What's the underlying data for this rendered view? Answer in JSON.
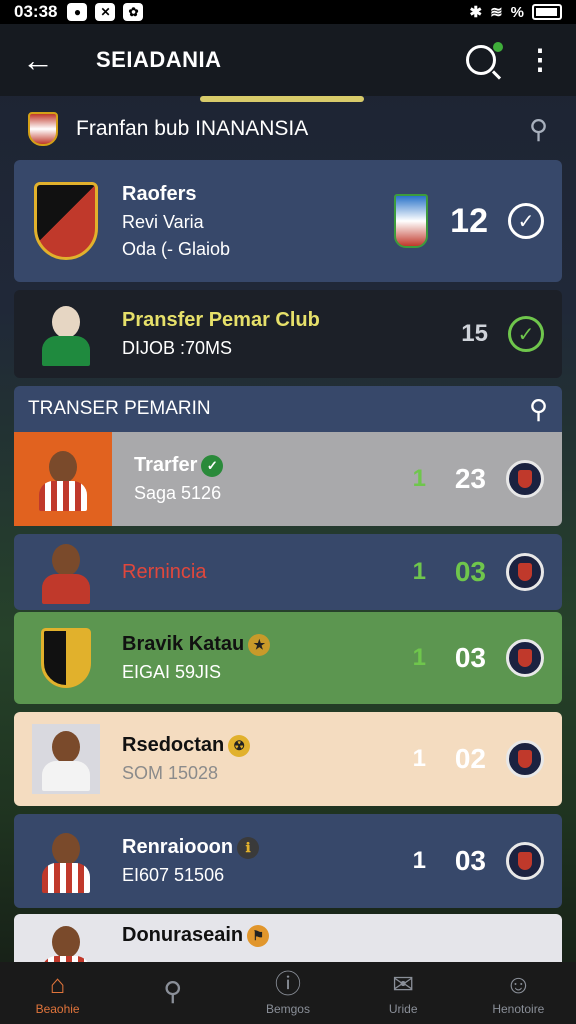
{
  "status_bar": {
    "time": "03:38",
    "battery": "%"
  },
  "app_bar": {
    "title": "SEIADANIA",
    "back_icon": "back-arrow-icon"
  },
  "section": {
    "title": "Franfan bub INANANSIA"
  },
  "cards": [
    {
      "name": "Raofers",
      "line1": "Revi Varia",
      "line2": "Oda (- Glaiob",
      "score": "12"
    },
    {
      "name": "Pransfer Pemar Club",
      "line2": "DIJOB :70MS",
      "score": "15"
    }
  ],
  "transfer": {
    "title": "TRANSER PEMARIN",
    "rows": [
      {
        "name": "Trarfer",
        "sub": "Saga 5126",
        "small": "1",
        "score": "23"
      },
      {
        "name": "Rernincia",
        "sub": "",
        "small": "1",
        "score": "03"
      },
      {
        "name": "Bravik Katau",
        "sub": "EIGAI 59JIS",
        "small": "1",
        "score": "03"
      },
      {
        "name": "Rsedoctan",
        "sub": "SOM 15028",
        "small": "1",
        "score": "02"
      },
      {
        "name": "Renraiooon",
        "sub": "EI607 51506",
        "small": "1",
        "score": "03"
      },
      {
        "name": "Donuraseain",
        "sub": "",
        "small": "",
        "score": ""
      }
    ]
  },
  "nav": [
    {
      "label": "Beaohie",
      "icon": "home-icon"
    },
    {
      "label": "",
      "icon": "search-icon"
    },
    {
      "label": "Bemgos",
      "icon": "info-icon"
    },
    {
      "label": "Uride",
      "icon": "mail-icon"
    },
    {
      "label": "Henotoire",
      "icon": "profile-icon"
    }
  ],
  "colors": {
    "accent": "#e0743b",
    "card_blue": "#37486a",
    "card_green": "#5c9650"
  }
}
